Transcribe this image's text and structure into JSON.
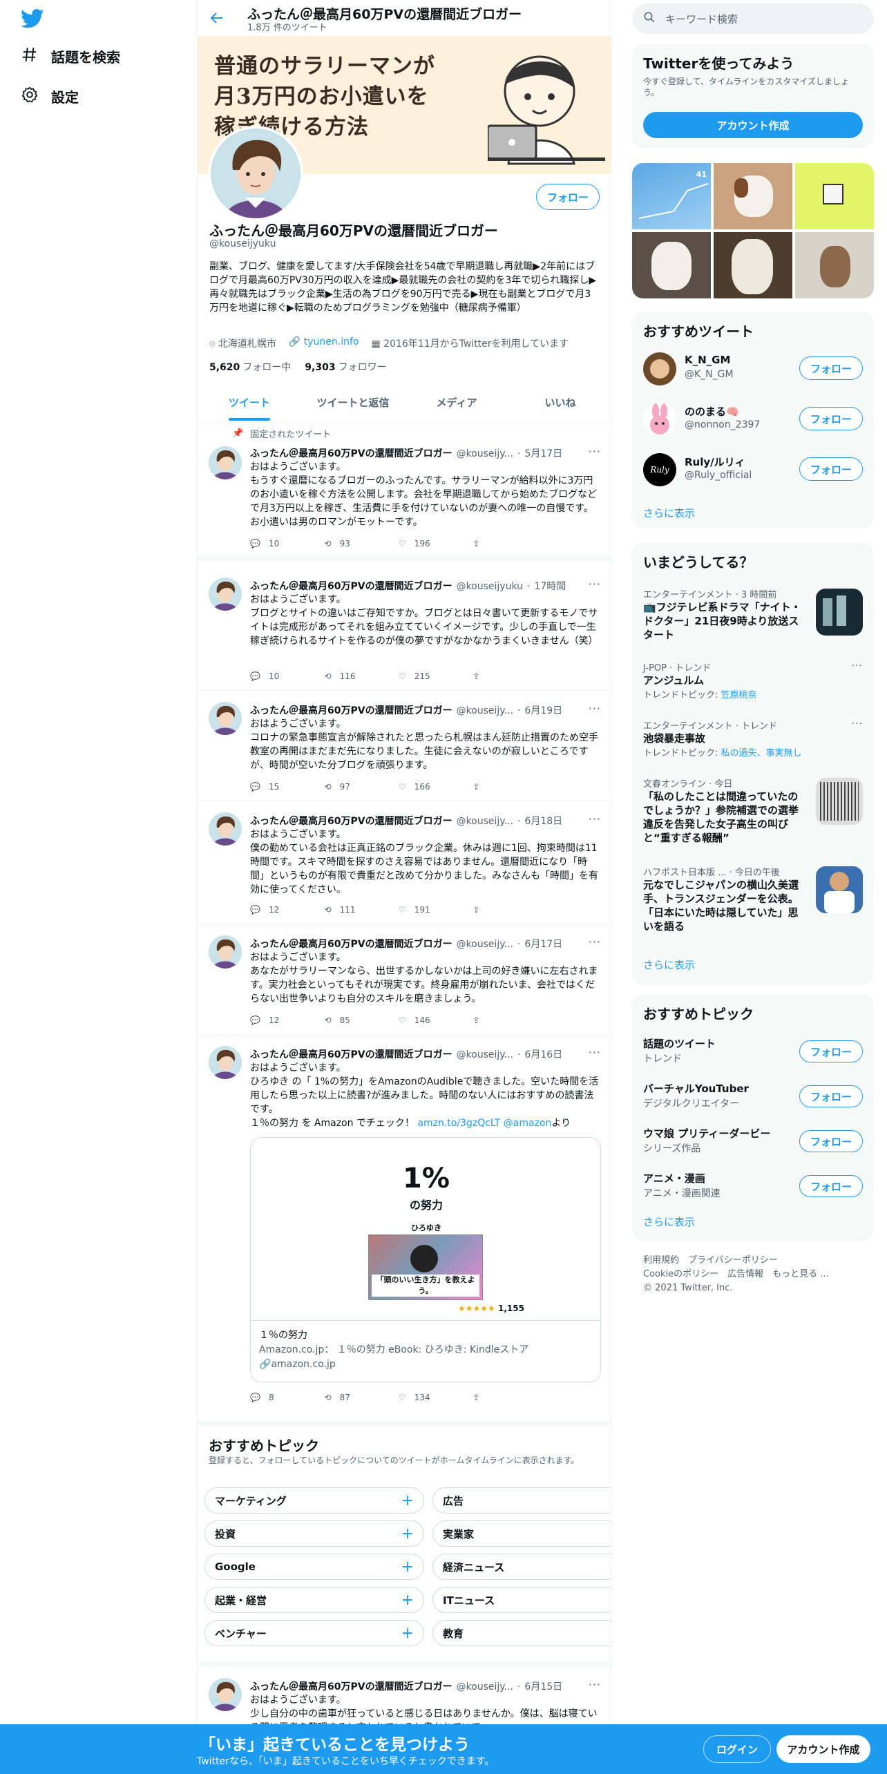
{
  "nav": {
    "explore_label": "話題を検索",
    "settings_label": "設定"
  },
  "header": {
    "title": "ふったん＠最高月60万PVの還暦間近ブロガー",
    "tweet_count": "1.8万 件のツイート"
  },
  "banner": {
    "line1": "普通のサラリーマンが",
    "line2": "月3万円のお小遣いを",
    "line3": "稼ぎ続ける方法"
  },
  "profile": {
    "follow_label": "フォロー",
    "name": "ふったん＠最高月60万PVの還暦間近ブロガー",
    "handle": "@kouseijyuku",
    "bio": "副業、ブログ、健康を愛してます/大手保険会社を54歳で早期退職し再就職▶2年前にはブログで月最高60万PV30万円の収入を達成▶最就職先の会社の契約を3年で切られ職探し▶再々就職先はブラック企業▶生活の為ブログを90万円で売る▶現在も副業とブログで月3万円を地道に稼ぐ▶転職のためプログラミングを勉強中（糖尿病予備軍）",
    "location": "北海道札幌市",
    "website": "tyunen.info",
    "joined": "2016年11月からTwitterを利用しています",
    "following_count": "5,620",
    "following_label": "フォロー中",
    "followers_count": "9,303",
    "followers_label": "フォロワー"
  },
  "tabs": [
    "ツイート",
    "ツイートと返信",
    "メディア",
    "いいね"
  ],
  "pinned_label": "固定されたツイート",
  "tweets": [
    {
      "name": "ふったん＠最高月60万PVの還暦間近ブロガー",
      "handle": "@kouseijy...",
      "time": "5月17日",
      "text": "おはようございます。\nもうすぐ還暦になるブロガーのふったんです。サラリーマンが給料以外に3万円のお小遣いを稼ぐ方法を公開します。会社を早期退職してから始めたブログなどで月3万円以上を稼ぎ、生活費に手を付けていないのが妻への唯一の自慢です。お小遣いは男のロマンがモットーです。",
      "reply": "10",
      "retweet": "93",
      "like": "196"
    },
    {
      "name": "ふったん＠最高月60万PVの還暦間近ブロガー",
      "handle": "@kouseijyuku",
      "time": "17時間",
      "text": "おはようございます。\nブログとサイトの違いはご存知ですか。ブログとは日々書いて更新するモノでサイトは完成形があってそれを組み立てていくイメージです。少しの手直しで一生稼ぎ続けられるサイトを作るのが僕の夢ですがなかなかうまくいきません（笑）",
      "reply": "10",
      "retweet": "116",
      "like": "215"
    },
    {
      "name": "ふったん＠最高月60万PVの還暦間近ブロガー",
      "handle": "@kouseijy...",
      "time": "6月19日",
      "text": "おはようございます。\nコロナの緊急事態宣言が解除されたと思ったら札幌はまん延防止措置のため空手教室の再開はまだまだ先になりました。生徒に会えないのが寂しいところですが、時間が空いた分ブログを頑張ります。",
      "reply": "15",
      "retweet": "97",
      "like": "166"
    },
    {
      "name": "ふったん＠最高月60万PVの還暦間近ブロガー",
      "handle": "@kouseijy...",
      "time": "6月18日",
      "text": "おはようございます。\n僕の勤めている会社は正真正銘のブラック企業。休みは週に1回、拘束時間は11時間です。スキマ時間を探すのさえ容易ではありません。還暦間近になり「時間」というものが有限で貴重だと改めて分かりました。みなさんも「時間」を有効に使ってください。",
      "reply": "12",
      "retweet": "111",
      "like": "191"
    },
    {
      "name": "ふったん＠最高月60万PVの還暦間近ブロガー",
      "handle": "@kouseijy...",
      "time": "6月17日",
      "text": "おはようございます。\nあなたがサラリーマンなら、出世するかしないかは上司の好き嫌いに左右されます。実力社会といってもそれが現実です。終身雇用が崩れたいま、会社ではくだらない出世争いよりも自分のスキルを磨きましょう。",
      "reply": "12",
      "retweet": "85",
      "like": "146"
    },
    {
      "name": "ふったん＠最高月60万PVの還暦間近ブロガー",
      "handle": "@kouseijy...",
      "time": "6月16日",
      "text": "おはようございます。\nひろゆき の「 1%の努力」をAmazonのAudibleで聴きました。空いた時間を活用したら思った以上に読書?が進みました。時間のない人にはおすすめの読書法です。",
      "share_prefix": "１％の努力 を Amazon でチェック！ ",
      "share_link": "amzn.to/3gzQcLT @amazon",
      "share_suffix": "より",
      "reply": "8",
      "retweet": "87",
      "like": "134"
    },
    {
      "name": "ふったん＠最高月60万PVの還暦間近ブロガー",
      "handle": "@kouseijy...",
      "time": "6月15日",
      "text": "おはようございます。\n少し自分の中の歯車が狂っていると感じる日はありませんか。僕は、脳は寝ている間に思考を整理すると言われていると書かれていて…"
    }
  ],
  "card": {
    "book_title": "1%",
    "book_sub": "の努力",
    "author": "ひろゆき",
    "book_banner": "「頭のいい生き方」を教えよう。",
    "rating_count": "1,155",
    "title": "１％の努力",
    "desc": "Amazon.co.jp： １％の努力 eBook: ひろゆき: Kindleストア",
    "domain": "amazon.co.jp"
  },
  "topics": {
    "title": "おすすめトピック",
    "desc": "登録すると、フォローしているトピックについてのツイートがホームタイムラインに表示されます。",
    "left": [
      "マーケティング",
      "投資",
      "Google",
      "起業・経営",
      "ベンチャー"
    ],
    "right": [
      "広告",
      "実業家",
      "経済ニュース",
      "ITニュース",
      "教育"
    ]
  },
  "search": {
    "placeholder": "キーワード検索"
  },
  "signup": {
    "title": "Twitterを使ってみよう",
    "desc": "今すぐ登録して、タイムラインをカスタマイズしましょう。",
    "button": "アカウント作成"
  },
  "media_label": "41",
  "recommended": {
    "title": "おすすめツイート",
    "users": [
      {
        "name": "K_N_GM",
        "handle": "@K_N_GM"
      },
      {
        "name": "ののまる🧠",
        "handle": "@nonnon_2397"
      },
      {
        "name": "Ruly/ルリィ",
        "handle": "@Ruly_official"
      }
    ],
    "more": "さらに表示"
  },
  "trends": {
    "title": "いまどうしてる？",
    "items": [
      {
        "cat": "エンターテインメント · 3 時間前",
        "title": "📺フジテレビ系ドラマ「ナイト・ドクター」21日夜9時より放送スタート"
      },
      {
        "cat": "J-POP · トレンド",
        "title": "アンジュルム",
        "sub_prefix": "トレンドトピック: ",
        "sub_link": "笠原桃奈"
      },
      {
        "cat": "エンターテインメント · トレンド",
        "title": "池袋暴走事故",
        "sub_prefix": "トレンドトピック: ",
        "sub_link": "私の過失、事実無し"
      },
      {
        "cat": "文春オンライン · 今日",
        "title": "「私のしたことは間違っていたのでしょうか？」参院補選での選挙違反を告発した女子高生の叫びと“重すぎる報酬”"
      },
      {
        "cat": "ハフポスト日本版 ... · 今日の午後",
        "title": "元なでしこジャパンの横山久美選手、トランスジェンダーを公表。「日本にいた時は隠していた」思いを語る"
      }
    ],
    "more": "さらに表示"
  },
  "right_topics": {
    "title": "おすすめトピック",
    "items": [
      {
        "name": "話題のツイート",
        "sub": "トレンド"
      },
      {
        "name": "バーチャルYouTuber",
        "sub": "デジタルクリエイター"
      },
      {
        "name": "ウマ娘 プリティーダービー",
        "sub": "シリーズ作品"
      },
      {
        "name": "アニメ・漫画",
        "sub": "アニメ・漫画関連"
      }
    ],
    "more": "さらに表示"
  },
  "footer": {
    "line1": "利用規約　プライバシーポリシー",
    "line2": "Cookieのポリシー　広告情報　もっと見る ...",
    "line3": "© 2021 Twitter, Inc."
  },
  "bottombar": {
    "title": "「いま」起きていることを見つけよう",
    "sub": "Twitterなら、「いま」起きていることをいち早くチェックできます。",
    "login": "ログイン",
    "signup": "アカウント作成"
  },
  "colors": {
    "accent": "#1d9bf0",
    "text": "#0f1419",
    "muted": "#536471",
    "banner_bg": "#fdf1dc"
  }
}
